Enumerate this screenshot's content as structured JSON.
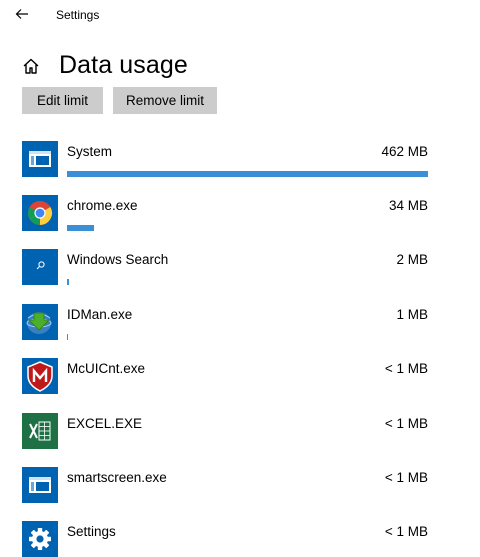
{
  "window": {
    "title": "Settings"
  },
  "page": {
    "title": "Data usage"
  },
  "buttons": {
    "edit_limit": "Edit limit",
    "remove_limit": "Remove limit"
  },
  "colors": {
    "bar": "#3a8fd6",
    "button_bg": "#cccccc",
    "tile_blue": "#0063b1"
  },
  "apps": [
    {
      "name": "System",
      "size": "462 MB",
      "usage_fraction": 1.0,
      "icon": "system-window-icon"
    },
    {
      "name": "chrome.exe",
      "size": "34 MB",
      "usage_fraction": 0.074,
      "icon": "chrome-icon"
    },
    {
      "name": "Windows Search",
      "size": "2 MB",
      "usage_fraction": 0.004,
      "icon": "search-icon"
    },
    {
      "name": "IDMan.exe",
      "size": "1 MB",
      "usage_fraction": 0.003,
      "icon": "idm-icon"
    },
    {
      "name": "McUICnt.exe",
      "size": "< 1 MB",
      "usage_fraction": 0.0,
      "icon": "mcafee-icon"
    },
    {
      "name": "EXCEL.EXE",
      "size": "< 1 MB",
      "usage_fraction": 0.0,
      "icon": "excel-icon"
    },
    {
      "name": "smartscreen.exe",
      "size": "< 1 MB",
      "usage_fraction": 0.0,
      "icon": "smartscreen-icon"
    },
    {
      "name": "Settings",
      "size": "< 1 MB",
      "usage_fraction": 0.0,
      "icon": "gear-icon"
    }
  ]
}
